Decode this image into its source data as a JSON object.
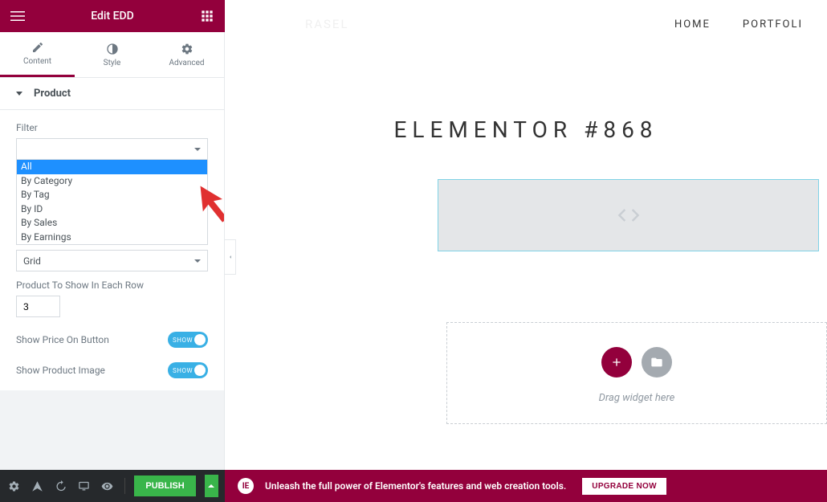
{
  "header": {
    "title": "Edit EDD"
  },
  "tabs": {
    "content": "Content",
    "style": "Style",
    "advanced": "Advanced"
  },
  "section": {
    "product": "Product"
  },
  "product": {
    "filter_label": "Filter",
    "filter_value": "",
    "filter_options": [
      "All",
      "By Category",
      "By Tag",
      "By ID",
      "By Sales",
      "By Earnings"
    ],
    "layout_label": "Grid",
    "rows_label": "Product To Show In Each Row",
    "rows_value": "3",
    "price_label": "Show Price On Button",
    "image_label": "Show Product Image",
    "toggle_text": "SHOW"
  },
  "footer": {
    "publish": "PUBLISH"
  },
  "preview": {
    "brand": "RASEL",
    "nav_home": "HOME",
    "nav_portfolio": "PORTFOLI",
    "title": "ELEMENTOR #868",
    "drop_text": "Drag widget here"
  },
  "upgrade": {
    "text": "Unleash the full power of Elementor's features and web creation tools.",
    "button": "UPGRADE NOW",
    "badge": "IE"
  }
}
